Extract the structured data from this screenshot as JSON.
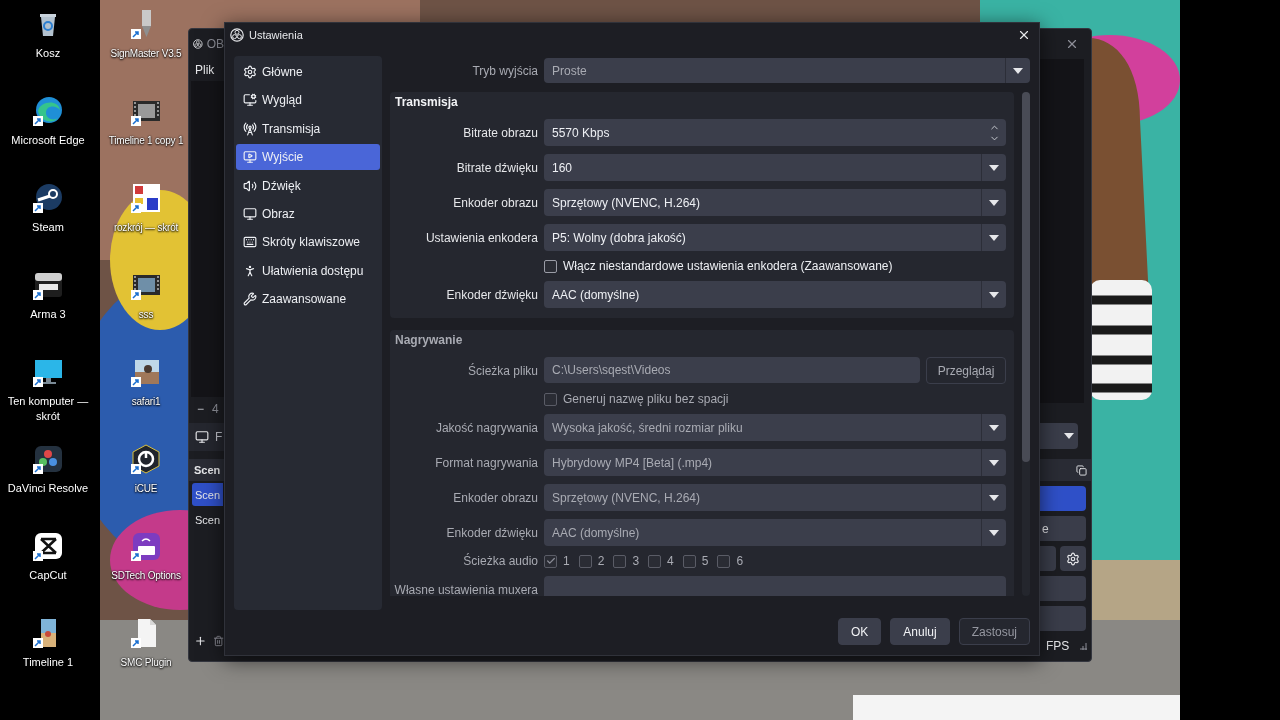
{
  "desktop": {
    "left_icons": [
      {
        "label": "Kosz"
      },
      {
        "label": "Microsoft Edge"
      },
      {
        "label": "Steam"
      },
      {
        "label": "Arma 3"
      },
      {
        "label": "Ten komputer — skrót"
      },
      {
        "label": "DaVinci Resolve"
      },
      {
        "label": "CapCut"
      },
      {
        "label": "Timeline 1"
      }
    ],
    "right_icons": [
      {
        "label": "SignMaster V3.5"
      },
      {
        "label": "Timeline 1 copy 1"
      },
      {
        "label": "rozkrój — skrót"
      },
      {
        "label": "sss"
      },
      {
        "label": "safari1"
      },
      {
        "label": "iCUE"
      },
      {
        "label": "SDTech Options"
      },
      {
        "label": "SMC Plugin"
      }
    ]
  },
  "obs_window": {
    "title": "OB",
    "menu": [
      "Plik"
    ],
    "zoom_out": "−",
    "zoom_fragment": "4",
    "dock_tab_fragment": "F",
    "scenes_title": "Scen",
    "scenes": [
      {
        "label": "Scen",
        "selected": true
      },
      {
        "label": "Scen",
        "selected": false
      }
    ],
    "control_fragment": "e",
    "status": "FPS"
  },
  "settings": {
    "title": "Ustawienia",
    "sidebar": [
      {
        "label": "Główne",
        "selected": false
      },
      {
        "label": "Wygląd",
        "selected": false
      },
      {
        "label": "Transmisja",
        "selected": false
      },
      {
        "label": "Wyjście",
        "selected": true
      },
      {
        "label": "Dźwięk",
        "selected": false
      },
      {
        "label": "Obraz",
        "selected": false
      },
      {
        "label": "Skróty klawiszowe",
        "selected": false
      },
      {
        "label": "Ułatwienia dostępu",
        "selected": false
      },
      {
        "label": "Zaawansowane",
        "selected": false
      }
    ],
    "output_mode": {
      "label": "Tryb wyjścia",
      "value": "Proste",
      "disabled": true
    },
    "groups": [
      {
        "title": "Transmisja",
        "disabled": false,
        "rows": [
          {
            "kind": "spin",
            "label": "Bitrate obrazu",
            "value": "5570 Kbps"
          },
          {
            "kind": "select",
            "label": "Bitrate dźwięku",
            "value": "160"
          },
          {
            "kind": "select",
            "label": "Enkoder obrazu",
            "value": "Sprzętowy (NVENC, H.264)"
          },
          {
            "kind": "select",
            "label": "Ustawienia enkodera",
            "value": "P5: Wolny (dobra jakość)"
          },
          {
            "kind": "checkbox",
            "text": "Włącz niestandardowe ustawienia enkodera (Zaawansowane)",
            "checked": false
          },
          {
            "kind": "select",
            "label": "Enkoder dźwięku",
            "value": "AAC (domyślne)"
          }
        ]
      },
      {
        "title": "Nagrywanie",
        "disabled": true,
        "rows": [
          {
            "kind": "path",
            "label": "Ścieżka pliku",
            "value": "C:\\Users\\sqest\\Videos",
            "button": "Przeglądaj"
          },
          {
            "kind": "checkbox",
            "text": "Generuj nazwę pliku bez spacji",
            "checked": false
          },
          {
            "kind": "select",
            "label": "Jakość nagrywania",
            "value": "Wysoka jakość, średni rozmiar pliku"
          },
          {
            "kind": "select",
            "label": "Format nagrywania",
            "value": "Hybrydowy MP4 [Beta] (.mp4)"
          },
          {
            "kind": "select",
            "label": "Enkoder obrazu",
            "value": "Sprzętowy (NVENC, H.264)"
          },
          {
            "kind": "select",
            "label": "Enkoder dźwięku",
            "value": "AAC (domyślne)"
          },
          {
            "kind": "tracks",
            "label": "Ścieżka audio",
            "tracks": [
              {
                "label": "1",
                "checked": true
              },
              {
                "label": "2",
                "checked": false
              },
              {
                "label": "3",
                "checked": false
              },
              {
                "label": "4",
                "checked": false
              },
              {
                "label": "5",
                "checked": false
              },
              {
                "label": "6",
                "checked": false
              }
            ]
          },
          {
            "kind": "text",
            "label": "Własne ustawienia muxera"
          }
        ]
      }
    ],
    "buttons": [
      {
        "label": "OK",
        "disabled": false
      },
      {
        "label": "Anuluj",
        "disabled": false
      },
      {
        "label": "Zastosuj",
        "disabled": true
      }
    ]
  }
}
